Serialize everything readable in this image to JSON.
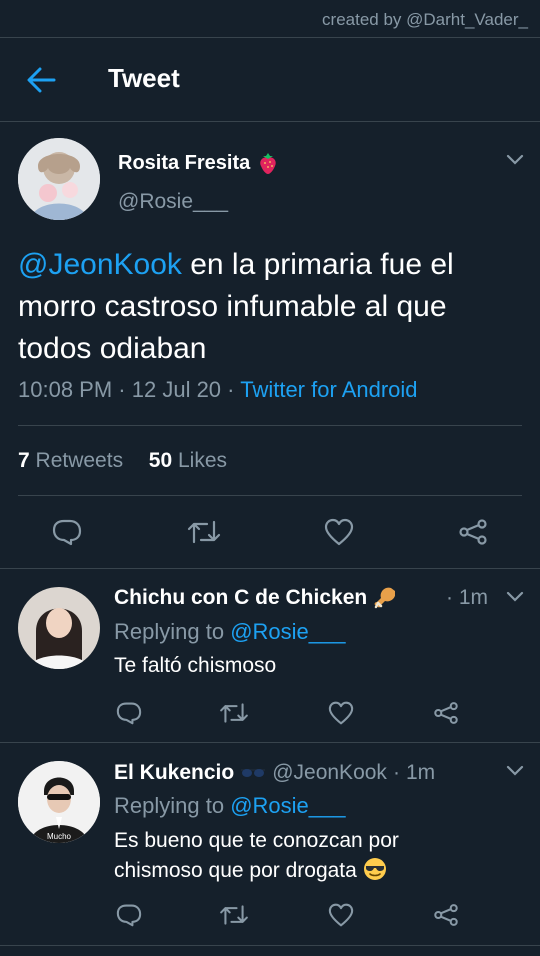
{
  "watermark": "created by @Darht_Vader_",
  "header": {
    "title": "Tweet"
  },
  "main": {
    "name": "Rosita Fresita",
    "handle": "@Rosie___",
    "mention": "@JeonKook",
    "text": " en la primaria fue el morro castroso infumable al que todos odiaban",
    "time": "10:08 PM",
    "date": "12 Jul 20",
    "client": "Twitter for Android",
    "retweets_count": "7",
    "retweets_label": "Retweets",
    "likes_count": "50",
    "likes_label": "Likes"
  },
  "replies": [
    {
      "name": "Chichu con C de Chicken",
      "time": "1m",
      "replying_label": "Replying to",
      "replying_to": "@Rosie___",
      "text": "Te faltó chismoso"
    },
    {
      "name": "El Kukencio",
      "handle": "@JeonKook",
      "time": "1m",
      "replying_label": "Replying to",
      "replying_to": "@Rosie___",
      "text": "Es bueno que te conozcan por chismoso que por drogata",
      "avatar_text": "Mucho"
    }
  ],
  "separator": "·",
  "colors": {
    "background": "#15202b",
    "accent": "#1da1f2",
    "muted": "#8899a6",
    "border": "#38444d"
  }
}
